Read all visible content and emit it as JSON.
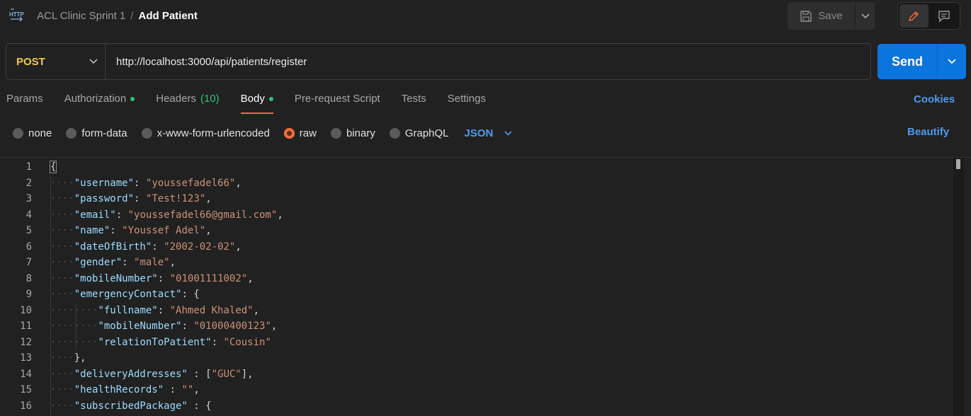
{
  "header": {
    "collection": "ACL Clinic Sprint 1",
    "separator": "/",
    "request_name": "Add Patient",
    "save_label": "Save"
  },
  "request": {
    "method": "POST",
    "url": "http://localhost:3000/api/patients/register",
    "send_label": "Send"
  },
  "tabs": [
    {
      "label": "Params"
    },
    {
      "label": "Authorization"
    },
    {
      "label": "Headers",
      "count": "(10)"
    },
    {
      "label": "Body"
    },
    {
      "label": "Pre-request Script"
    },
    {
      "label": "Tests"
    },
    {
      "label": "Settings"
    }
  ],
  "cookies_label": "Cookies",
  "body_types": [
    "none",
    "form-data",
    "x-www-form-urlencoded",
    "raw",
    "binary",
    "GraphQL"
  ],
  "body_format": "JSON",
  "beautify_label": "Beautify",
  "colors": {
    "accent_orange": "#f26b3a",
    "send_blue": "#0c74dd",
    "link_blue": "#4d9bee",
    "method_yellow": "#f2c94c",
    "json_key": "#9cdcfe",
    "json_string": "#ce9178",
    "status_dot": "#2ec27e"
  },
  "editor": {
    "lines": [
      {
        "n": "1",
        "t": "{"
      },
      {
        "n": "2",
        "t": "    \"username\": \"youssefadel66\","
      },
      {
        "n": "3",
        "t": "    \"password\": \"Test!123\","
      },
      {
        "n": "4",
        "t": "    \"email\": \"youssefadel66@gmail.com\","
      },
      {
        "n": "5",
        "t": "    \"name\": \"Youssef Adel\","
      },
      {
        "n": "6",
        "t": "    \"dateOfBirth\": \"2002-02-02\","
      },
      {
        "n": "7",
        "t": "    \"gender\": \"male\","
      },
      {
        "n": "8",
        "t": "    \"mobileNumber\": \"01001111002\","
      },
      {
        "n": "9",
        "t": "    \"emergencyContact\": {"
      },
      {
        "n": "10",
        "t": "        \"fullname\": \"Ahmed Khaled\","
      },
      {
        "n": "11",
        "t": "        \"mobileNumber\": \"01000400123\","
      },
      {
        "n": "12",
        "t": "        \"relationToPatient\": \"Cousin\""
      },
      {
        "n": "13",
        "t": "    },"
      },
      {
        "n": "14",
        "t": "    \"deliveryAddresses\" : [\"GUC\"],"
      },
      {
        "n": "15",
        "t": "    \"healthRecords\" : \"\","
      },
      {
        "n": "16",
        "t": "    \"subscribedPackage\" : {"
      }
    ]
  }
}
